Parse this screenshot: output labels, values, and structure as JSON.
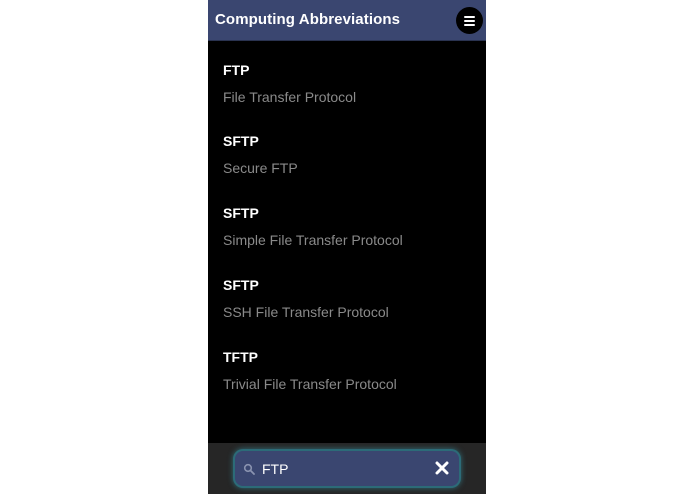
{
  "app": {
    "title": "Computing Abbreviations",
    "menu_icon": "hamburger-menu-icon"
  },
  "results": [
    {
      "abbreviation": "FTP",
      "meaning": "File Transfer Protocol"
    },
    {
      "abbreviation": "SFTP",
      "meaning": "Secure FTP"
    },
    {
      "abbreviation": "SFTP",
      "meaning": "Simple File Transfer Protocol"
    },
    {
      "abbreviation": "SFTP",
      "meaning": "SSH File Transfer Protocol"
    },
    {
      "abbreviation": "TFTP",
      "meaning": "Trivial File Transfer Protocol"
    }
  ],
  "search": {
    "value": "FTP",
    "icon": "search-icon",
    "clear_icon": "close-icon"
  },
  "colors": {
    "header_bg": "#3a4670",
    "screen_bg": "#000000",
    "abbreviation_text": "#ffffff",
    "meaning_text": "#8a8a8a",
    "footer_bg": "#262626",
    "search_glow": "#2c6b78"
  }
}
